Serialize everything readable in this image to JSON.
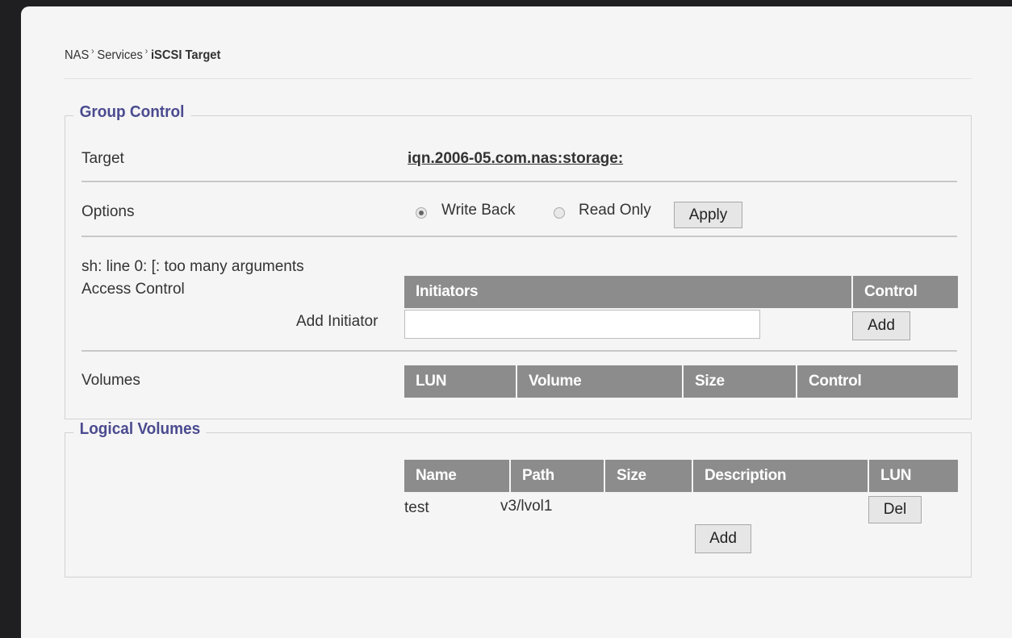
{
  "breadcrumb": {
    "items": [
      "NAS",
      "Services"
    ],
    "separator": "›",
    "current": "iSCSI Target"
  },
  "group_control": {
    "legend": "Group Control",
    "target": {
      "label": "Target",
      "value": "iqn.2006-05.com.nas:storage:"
    },
    "options": {
      "label": "Options",
      "radios": [
        {
          "label": "Write Back",
          "selected": true
        },
        {
          "label": "Read Only",
          "selected": false
        }
      ],
      "apply_label": "Apply"
    },
    "error_message": "sh: line 0: [: too many arguments",
    "access_control": {
      "label": "Access Control",
      "headers": [
        "Initiators",
        "Control"
      ],
      "add_initiator_label": "Add Initiator",
      "initiator_input_value": "",
      "add_label": "Add"
    },
    "volumes": {
      "label": "Volumes",
      "headers": [
        "LUN",
        "Volume",
        "Size",
        "Control"
      ]
    }
  },
  "logical_volumes": {
    "legend": "Logical Volumes",
    "headers": [
      "Name",
      "Path",
      "Size",
      "Description",
      "LUN"
    ],
    "rows": [
      {
        "name": "test",
        "path": "v3/lvol1",
        "size": "",
        "description": "",
        "action_label": "Del"
      }
    ],
    "add_label": "Add"
  },
  "colors": {
    "legend_text": "#4b4b90",
    "table_header_bg": "#8c8c8c",
    "page_bg": "#f5f5f5",
    "frame_bg": "#1f1f21"
  }
}
